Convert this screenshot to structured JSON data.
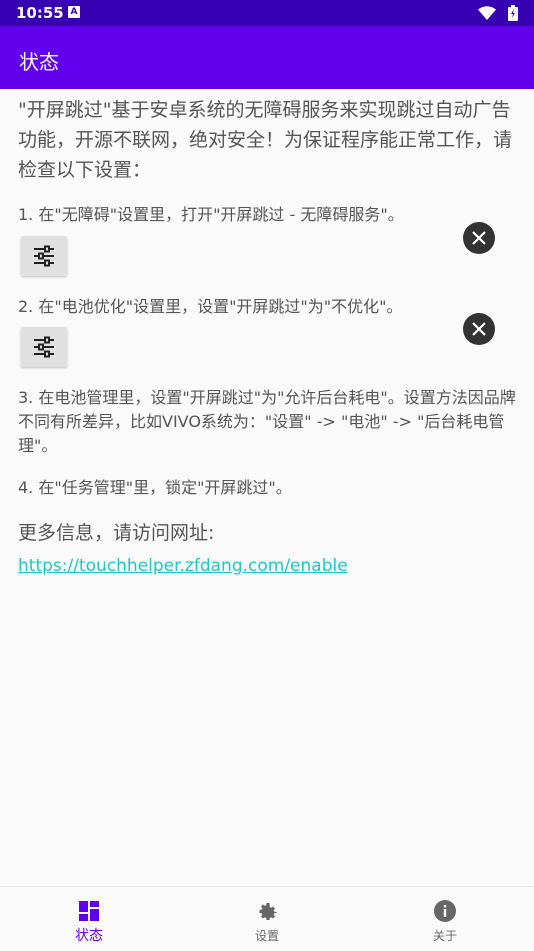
{
  "status_bar": {
    "time": "10:55",
    "notification_badge": "A",
    "icons": [
      "notification-icon",
      "wifi-icon",
      "battery-icon"
    ]
  },
  "app_bar": {
    "title": "状态"
  },
  "content": {
    "intro": "\"开屏跳过\"基于安卓系统的无障碍服务来实现跳过自动广告功能，开源不联网，绝对安全！为保证程序能正常工作，请检查以下设置：",
    "steps": [
      {
        "text": "1. 在\"无障碍\"设置里，打开\"开屏跳过 - 无障碍服务\"。",
        "has_button": true,
        "status": "not-enabled"
      },
      {
        "text": "2. 在\"电池优化\"设置里，设置\"开屏跳过\"为\"不优化\"。",
        "has_button": true,
        "status": "not-enabled"
      },
      {
        "text": "3. 在电池管理里，设置\"开屏跳过\"为\"允许后台耗电\"。设置方法因品牌不同有所差异，比如VIVO系统为：\"设置\" -> \"电池\" -> \"后台耗电管理\"。"
      },
      {
        "text": "4. 在\"任务管理\"里，锁定\"开屏跳过\"。"
      }
    ],
    "more_info": "更多信息，请访问网址:",
    "link": "https://touchhelper.zfdang.com/enable"
  },
  "bottom_nav": {
    "items": [
      {
        "label": "状态",
        "icon": "dashboard-icon",
        "active": true
      },
      {
        "label": "设置",
        "icon": "gear-icon",
        "active": false
      },
      {
        "label": "关于",
        "icon": "info-icon",
        "active": false
      }
    ],
    "active_color": "#6200ee"
  },
  "colors": {
    "status_bar": "#3700b3",
    "app_bar": "#6200ee",
    "link": "#1ec8c8"
  }
}
